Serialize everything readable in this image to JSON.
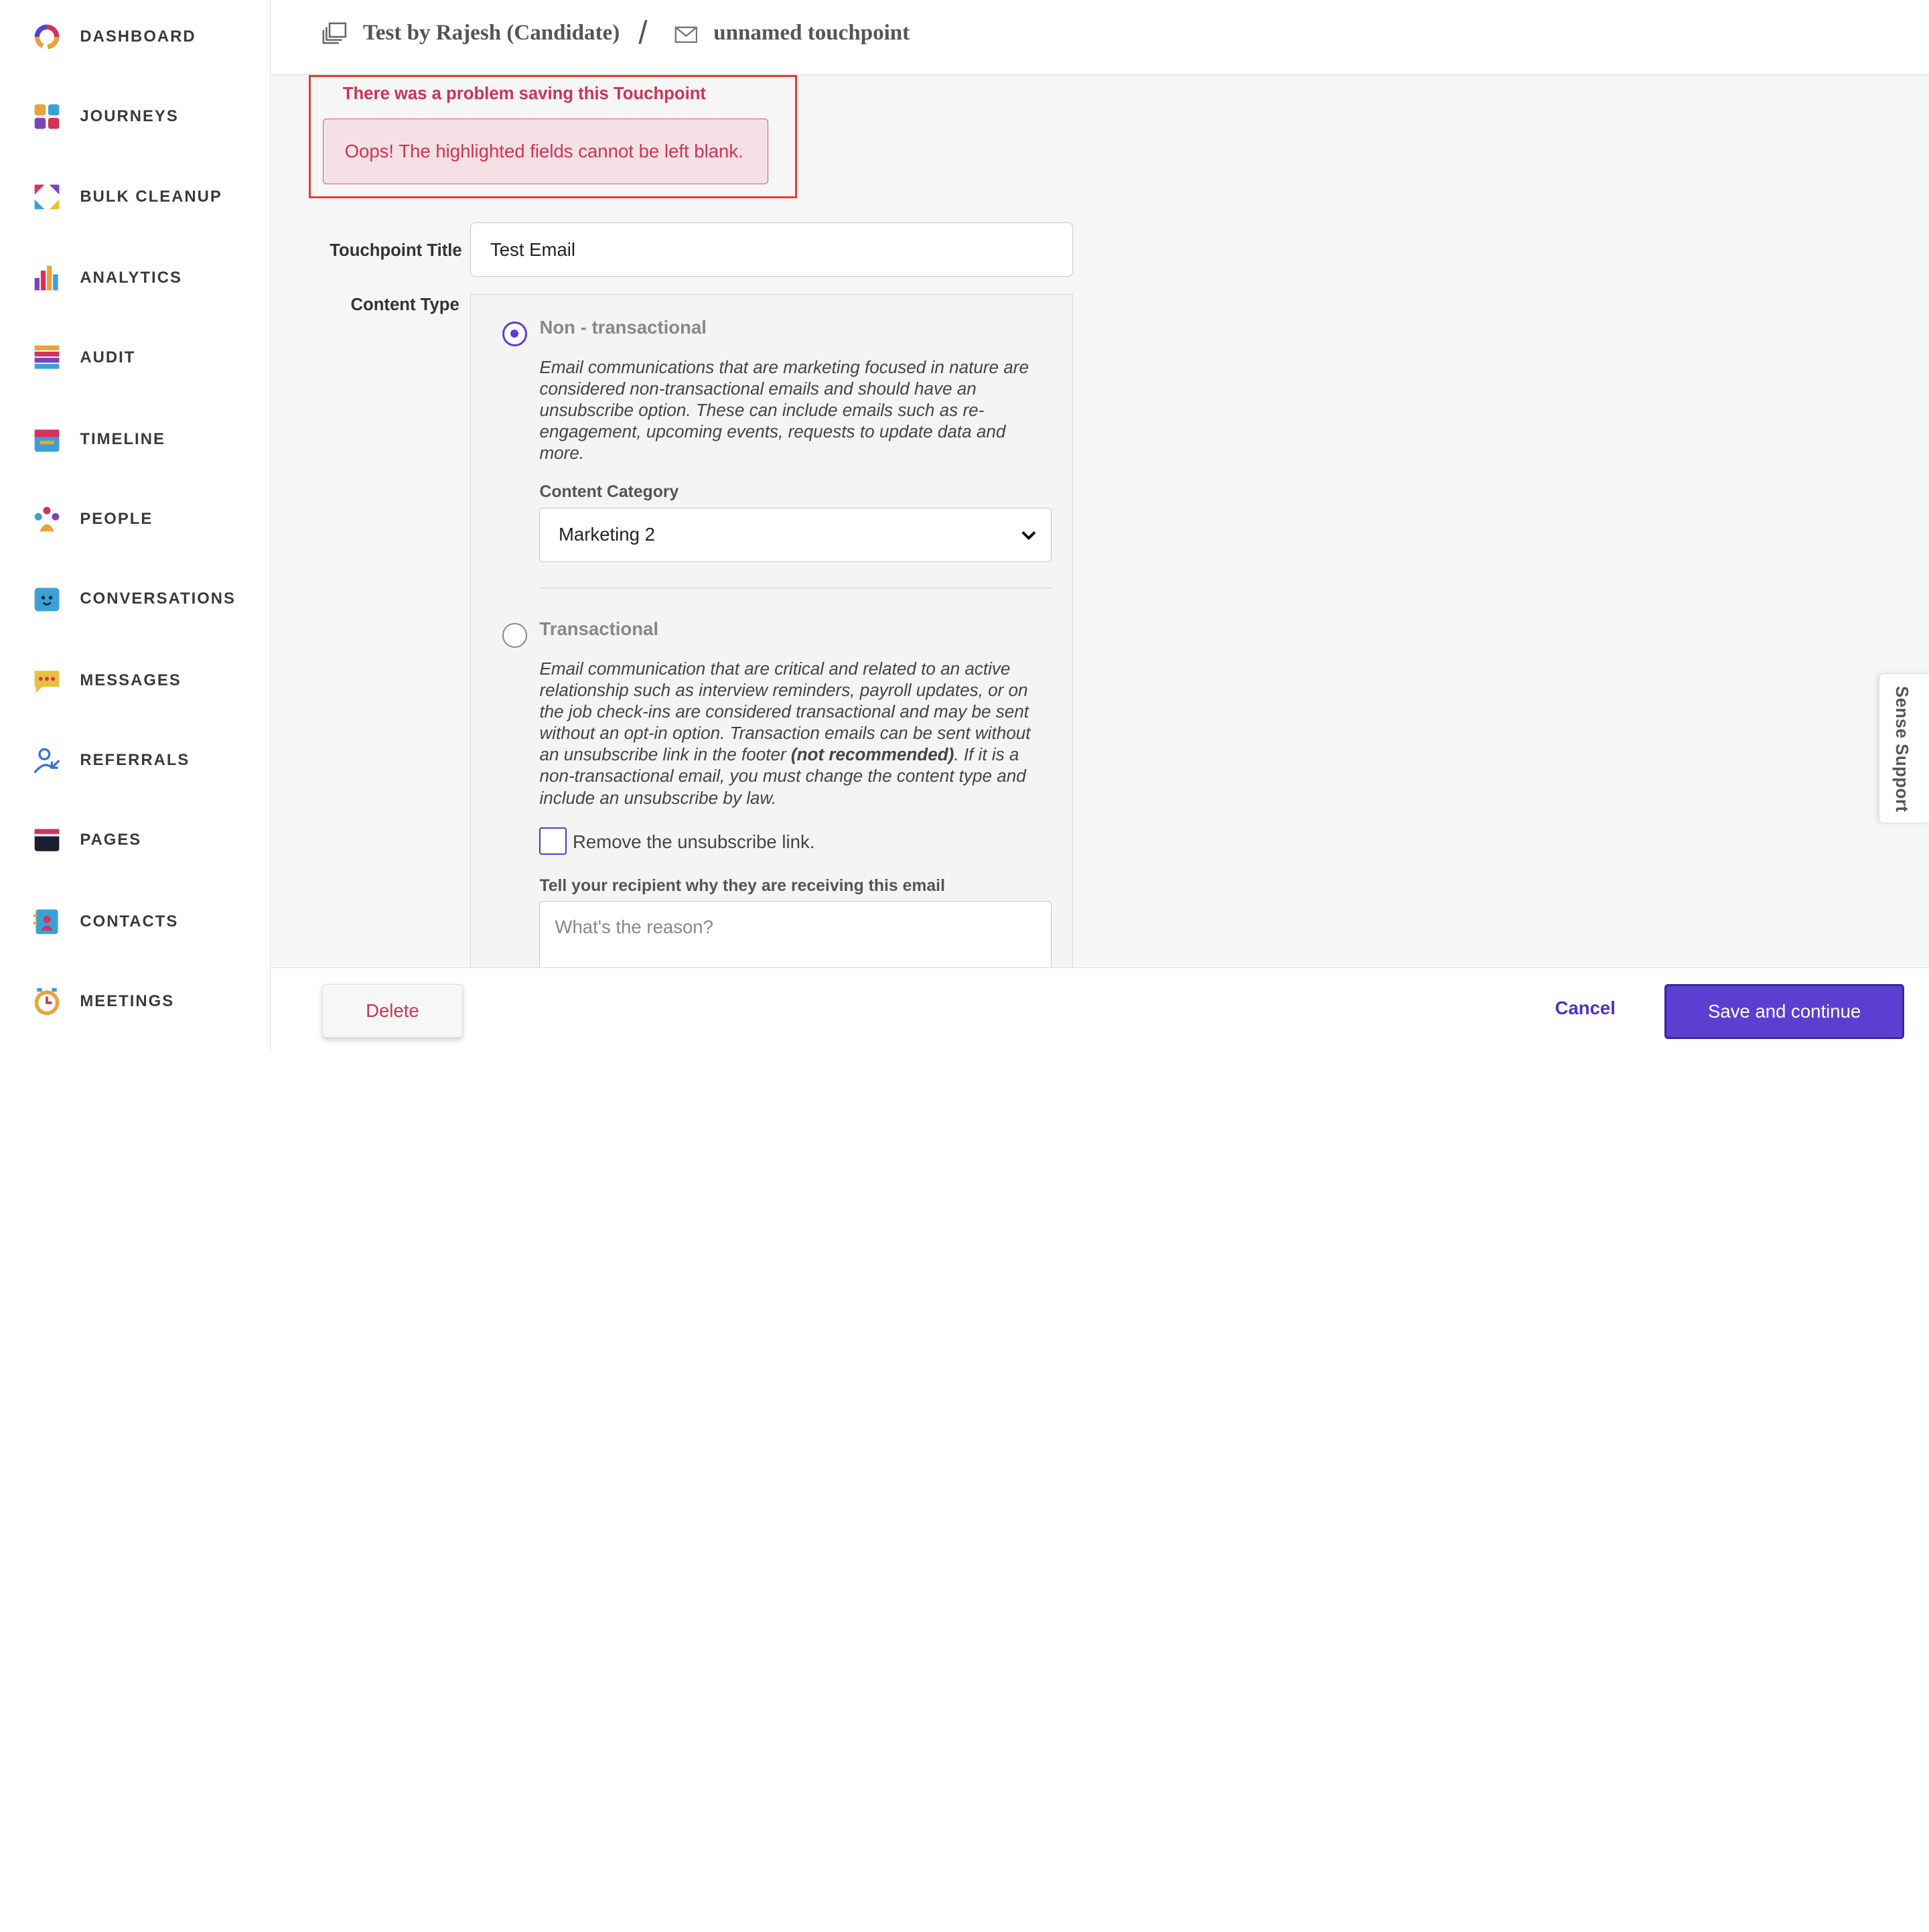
{
  "sidebar": {
    "items": [
      {
        "label": "DASHBOARD",
        "icon": "dashboard-icon"
      },
      {
        "label": "JOURNEYS",
        "icon": "journeys-icon"
      },
      {
        "label": "BULK CLEANUP",
        "icon": "bulk-cleanup-icon"
      },
      {
        "label": "ANALYTICS",
        "icon": "analytics-icon"
      },
      {
        "label": "AUDIT",
        "icon": "audit-icon"
      },
      {
        "label": "TIMELINE",
        "icon": "timeline-icon"
      },
      {
        "label": "PEOPLE",
        "icon": "people-icon"
      },
      {
        "label": "CONVERSATIONS",
        "icon": "conversations-icon"
      },
      {
        "label": "MESSAGES",
        "icon": "messages-icon"
      },
      {
        "label": "REFERRALS",
        "icon": "referrals-icon"
      },
      {
        "label": "PAGES",
        "icon": "pages-icon"
      },
      {
        "label": "CONTACTS",
        "icon": "contacts-icon"
      },
      {
        "label": "MEETINGS",
        "icon": "meetings-icon"
      }
    ]
  },
  "header": {
    "journey_name": "Test by Rajesh (Candidate)",
    "separator": "/",
    "touchpoint_name": "unnamed touchpoint"
  },
  "error": {
    "title": "There was a problem saving this Touchpoint",
    "message": "Oops! The highlighted fields cannot be left blank."
  },
  "form": {
    "title_label": "Touchpoint Title",
    "title_value": "Test Email",
    "content_type_label": "Content Type",
    "non_transactional": {
      "label": "Non - transactional",
      "description": "Email communications that are marketing focused in nature are considered non-transactional emails and should have an unsubscribe option. These can include emails such as re-engagement, upcoming events, requests to update data and more.",
      "category_label": "Content Category",
      "category_value": "Marketing 2"
    },
    "transactional": {
      "label": "Transactional",
      "description_part1": "Email communication that are critical and related to an active relationship such as interview reminders, payroll updates, or on the job check-ins are considered transactional and may be sent without an opt-in option. Transaction emails can be sent without an unsubscribe link in the footer ",
      "description_bold": "(not recommended)",
      "description_part2": ". If it is a non-transactional email, you must change the content type and include an unsubscribe by law.",
      "checkbox_label": "Remove the unsubscribe link.",
      "reason_label": "Tell your recipient why they are receiving this email",
      "reason_placeholder": "What's the reason?"
    }
  },
  "footer": {
    "delete_label": "Delete",
    "cancel_label": "Cancel",
    "save_label": "Save and continue"
  },
  "support": {
    "label": "Sense Support"
  },
  "colors": {
    "accent": "#5b3fd1",
    "error": "#cf3352",
    "error_border": "#e0412c"
  }
}
